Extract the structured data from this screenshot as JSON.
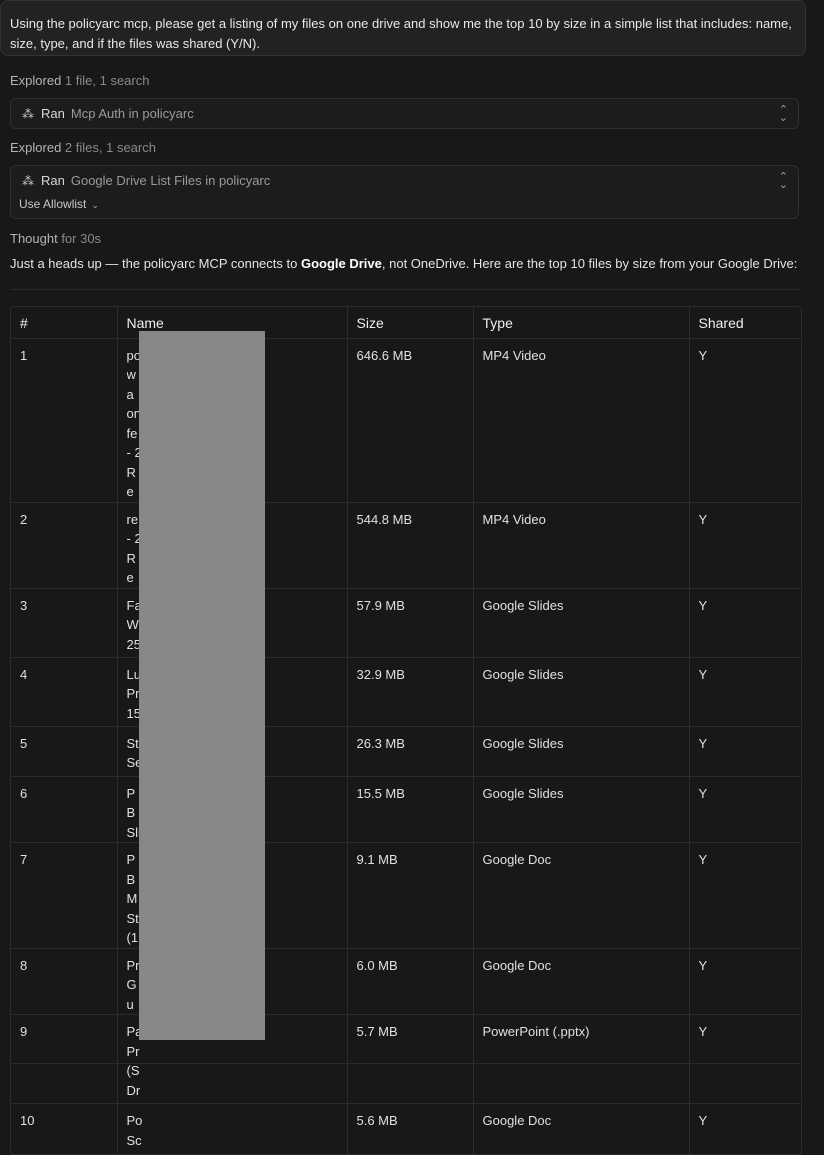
{
  "prompt": {
    "line1": "Using the policyarc mcp, please get a listing of my files on one drive and show me the top 10 by size in a simple list that includes: name,",
    "line2": "size, type, and if the files was shared (Y/N)."
  },
  "steps": [
    {
      "lead": "Explored",
      "detail": " 1 file, 1 search"
    },
    {
      "lead": "Explored",
      "detail": " 2 files, 1 search"
    }
  ],
  "tools": [
    {
      "verb": "Ran",
      "name": "Mcp Auth in policyarc"
    },
    {
      "verb": "Ran",
      "name": "Google Drive List Files in policyarc",
      "allowlist_label": "Use Allowlist"
    }
  ],
  "thought": {
    "lead": "Thought",
    "detail": " for 30s"
  },
  "answer": {
    "before": "Just a heads up — the policyarc MCP connects to ",
    "bold": "Google Drive",
    "after": ", not OneDrive. Here are the top 10 files by size from your Google Drive:"
  },
  "table": {
    "headers": [
      "#",
      "Name",
      "Size",
      "Type",
      "Shared"
    ],
    "rows": [
      {
        "num": "1",
        "name": "po\nwa\non\nfe\n- 2\nRe",
        "size": "646.6 MB",
        "type": "MP4 Video",
        "shared": "Y"
      },
      {
        "num": "2",
        "name": "re\n- 2\nRe",
        "size": "544.8 MB",
        "type": "MP4 Video",
        "shared": "Y"
      },
      {
        "num": "3",
        "name": "Fa\nW\n25",
        "size": "57.9 MB",
        "type": "Google Slides",
        "shared": "Y"
      },
      {
        "num": "4",
        "name": "Lu\nPr\n15",
        "size": "32.9 MB",
        "type": "Google Slides",
        "shared": "Y"
      },
      {
        "num": "5",
        "name": "St\nSe",
        "size": "26.3 MB",
        "type": "Google Slides",
        "shared": "Y"
      },
      {
        "num": "6",
        "name": "PB\nSli",
        "size": "15.5 MB",
        "type": "Google Slides",
        "shared": "Y"
      },
      {
        "num": "7",
        "name": "PB\nM\nSt\n(1",
        "size": "9.1 MB",
        "type": "Google Doc",
        "shared": "Y"
      },
      {
        "num": "8",
        "name": "Pr\nGu",
        "size": "6.0 MB",
        "type": "Google Doc",
        "shared": "Y"
      },
      {
        "num": "9",
        "name": "Pa\nPr\n(S\nDr",
        "size": "5.7 MB",
        "type": "PowerPoint (.pptx)",
        "shared": "Y"
      },
      {
        "num": "10",
        "name": "Po\nSc",
        "size": "5.6 MB",
        "type": "Google Doc",
        "shared": "Y"
      }
    ]
  }
}
